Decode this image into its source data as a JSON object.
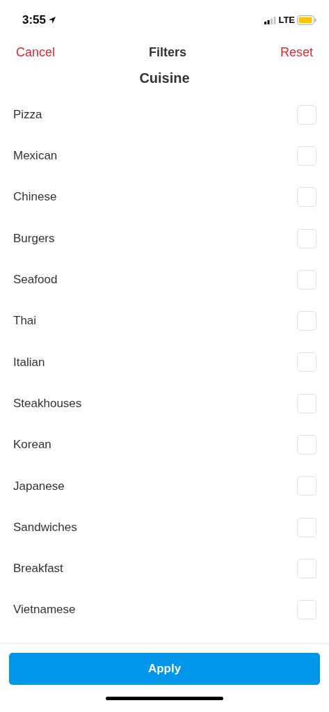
{
  "status_bar": {
    "time": "3:55",
    "network": "LTE"
  },
  "nav": {
    "cancel": "Cancel",
    "title": "Filters",
    "reset": "Reset"
  },
  "section_title": "Cuisine",
  "options": [
    {
      "label": "Pizza",
      "checked": false
    },
    {
      "label": "Mexican",
      "checked": false
    },
    {
      "label": "Chinese",
      "checked": false
    },
    {
      "label": "Burgers",
      "checked": false
    },
    {
      "label": "Seafood",
      "checked": false
    },
    {
      "label": "Thai",
      "checked": false
    },
    {
      "label": "Italian",
      "checked": false
    },
    {
      "label": "Steakhouses",
      "checked": false
    },
    {
      "label": "Korean",
      "checked": false
    },
    {
      "label": "Japanese",
      "checked": false
    },
    {
      "label": "Sandwiches",
      "checked": false
    },
    {
      "label": "Breakfast",
      "checked": false
    },
    {
      "label": "Vietnamese",
      "checked": false
    }
  ],
  "apply_button": "Apply"
}
